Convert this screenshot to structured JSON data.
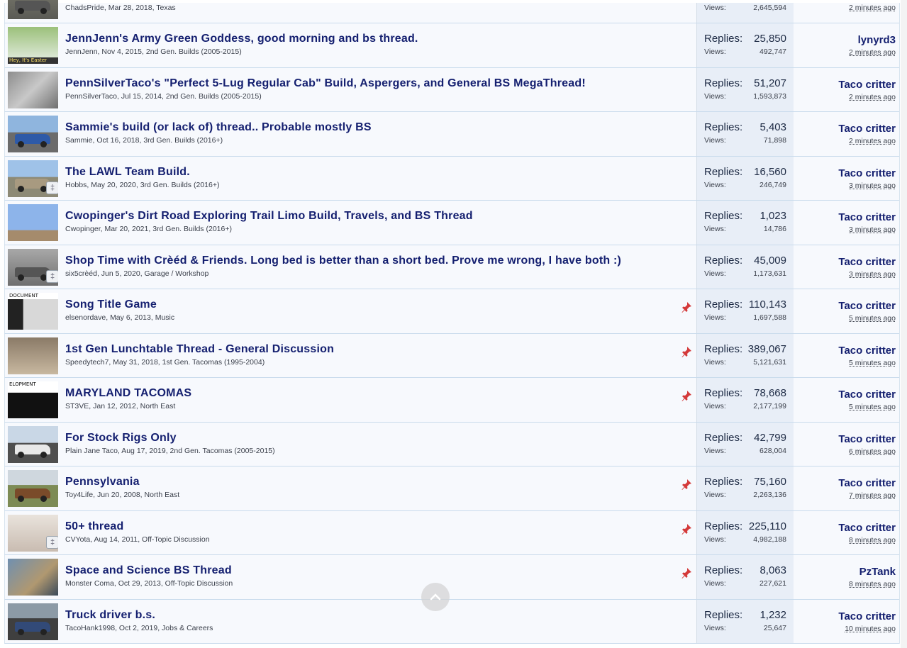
{
  "threads": [
    {
      "title": "",
      "author": "ChadsPride",
      "date": "Mar 28, 2018",
      "forum": "Texas",
      "replies": "",
      "views": "2,645,594",
      "last_user": "",
      "last_time": "2 minutes ago",
      "pinned": false,
      "badge": false
    },
    {
      "title": "JennJenn's Army Green Goddess, good morning and bs thread.",
      "author": "JennJenn",
      "date": "Nov 4, 2015",
      "forum": "2nd Gen. Builds (2005-2015)",
      "replies": "25,850",
      "views": "492,747",
      "last_user": "lynyrd3",
      "last_time": "2 minutes ago",
      "pinned": false,
      "badge": false,
      "thumb_text": "Hey, It's Easter"
    },
    {
      "title": "PennSilverTaco's \"Perfect 5-Lug Regular Cab\" Build, Aspergers, and General BS MegaThread!",
      "author": "PennSilverTaco",
      "date": "Jul 15, 2014",
      "forum": "2nd Gen. Builds (2005-2015)",
      "replies": "51,207",
      "views": "1,593,873",
      "last_user": "Taco critter",
      "last_time": "2 minutes ago",
      "pinned": false,
      "badge": false
    },
    {
      "title": "Sammie's build (or lack of) thread.. Probable mostly BS",
      "author": "Sammie",
      "date": "Oct 16, 2018",
      "forum": "3rd Gen. Builds (2016+)",
      "replies": "5,403",
      "views": "71,898",
      "last_user": "Taco critter",
      "last_time": "2 minutes ago",
      "pinned": false,
      "badge": false
    },
    {
      "title": "The LAWL Team Build.",
      "author": "Hobbs",
      "date": "May 20, 2020",
      "forum": "3rd Gen. Builds (2016+)",
      "replies": "16,560",
      "views": "246,749",
      "last_user": "Taco critter",
      "last_time": "3 minutes ago",
      "pinned": false,
      "badge": true
    },
    {
      "title": "Cwopinger's Dirt Road Exploring Trail Limo Build, Travels, and BS Thread",
      "author": "Cwopinger",
      "date": "Mar 20, 2021",
      "forum": "3rd Gen. Builds (2016+)",
      "replies": "1,023",
      "views": "14,786",
      "last_user": "Taco critter",
      "last_time": "3 minutes ago",
      "pinned": false,
      "badge": false
    },
    {
      "title": "Shop Time with Crèéd & Friends. Long bed is better than a short bed. Prove me wrong, I have both :)",
      "author": "six5crèéd",
      "date": "Jun 5, 2020",
      "forum": "Garage / Workshop",
      "replies": "45,009",
      "views": "1,173,631",
      "last_user": "Taco critter",
      "last_time": "3 minutes ago",
      "pinned": false,
      "badge": true
    },
    {
      "title": "Song Title Game",
      "author": "elsenordave",
      "date": "May 6, 2013",
      "forum": "Music",
      "replies": "110,143",
      "views": "1,697,588",
      "last_user": "Taco critter",
      "last_time": "5 minutes ago",
      "pinned": true,
      "badge": false,
      "thumb_text": "DOCUMENT"
    },
    {
      "title": "1st Gen Lunchtable Thread - General Discussion",
      "author": "Speedytech7",
      "date": "May 31, 2018",
      "forum": "1st Gen. Tacomas (1995-2004)",
      "replies": "389,067",
      "views": "5,121,631",
      "last_user": "Taco critter",
      "last_time": "5 minutes ago",
      "pinned": true,
      "badge": false
    },
    {
      "title": "MARYLAND TACOMAS",
      "author": "ST3VE",
      "date": "Jan 12, 2012",
      "forum": "North East",
      "replies": "78,668",
      "views": "2,177,199",
      "last_user": "Taco critter",
      "last_time": "5 minutes ago",
      "pinned": true,
      "badge": false,
      "thumb_text": "ELOPMENT"
    },
    {
      "title": "For Stock Rigs Only",
      "author": "Plain Jane Taco",
      "date": "Aug 17, 2019",
      "forum": "2nd Gen. Tacomas (2005-2015)",
      "replies": "42,799",
      "views": "628,004",
      "last_user": "Taco critter",
      "last_time": "6 minutes ago",
      "pinned": false,
      "badge": false
    },
    {
      "title": "Pennsylvania",
      "author": "Toy4Life",
      "date": "Jun 20, 2008",
      "forum": "North East",
      "replies": "75,160",
      "views": "2,263,136",
      "last_user": "Taco critter",
      "last_time": "7 minutes ago",
      "pinned": true,
      "badge": false
    },
    {
      "title": "50+ thread",
      "author": "CVYota",
      "date": "Aug 14, 2011",
      "forum": "Off-Topic Discussion",
      "replies": "225,110",
      "views": "4,982,188",
      "last_user": "Taco critter",
      "last_time": "8 minutes ago",
      "pinned": true,
      "badge": true
    },
    {
      "title": "Space and Science BS Thread",
      "author": "Monster Coma",
      "date": "Oct 29, 2013",
      "forum": "Off-Topic Discussion",
      "replies": "8,063",
      "views": "227,621",
      "last_user": "PzTank",
      "last_time": "8 minutes ago",
      "pinned": true,
      "badge": false
    },
    {
      "title": "Truck driver b.s.",
      "author": "TacoHank1998",
      "date": "Oct 2, 2019",
      "forum": "Jobs & Careers",
      "replies": "1,232",
      "views": "25,647",
      "last_user": "Taco critter",
      "last_time": "10 minutes ago",
      "pinned": false,
      "badge": false
    }
  ],
  "labels": {
    "replies": "Replies:",
    "views": "Views:"
  },
  "colors": {
    "title": "#152070",
    "stats_bg": "#e8eef7",
    "row_bg": "#f7f9fd",
    "pin": "#d43a3a"
  }
}
